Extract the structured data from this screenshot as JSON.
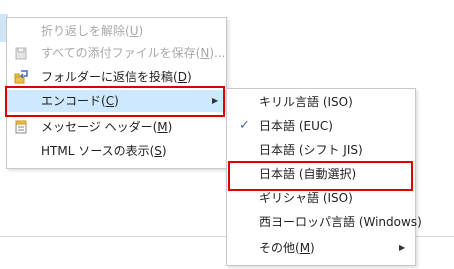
{
  "context_menu": {
    "items": [
      {
        "label": "折り返しを解除(",
        "mnemonic": "U",
        "suffix": ")",
        "disabled": true,
        "icon": "unwrap-icon"
      },
      {
        "label": "すべての添付ファイルを保存(",
        "mnemonic": "N",
        "suffix": ")...",
        "disabled": true,
        "icon": "save-attachments-icon"
      },
      {
        "label": "フォルダーに返信を投稿(",
        "mnemonic": "D",
        "suffix": ")",
        "disabled": false,
        "icon": "post-reply-folder-icon"
      },
      {
        "label": "エンコード(",
        "mnemonic": "C",
        "suffix": ")",
        "disabled": false,
        "active": true,
        "has_submenu": true
      },
      {
        "label": "メッセージ ヘッダー(",
        "mnemonic": "M",
        "suffix": ")",
        "disabled": false,
        "icon": "message-header-icon"
      },
      {
        "label": "HTML ソースの表示(",
        "mnemonic": "S",
        "suffix": ")",
        "disabled": false
      }
    ]
  },
  "encoding_submenu": {
    "items": [
      {
        "label": "キリル言語 (ISO)",
        "checked": false
      },
      {
        "label": "日本語 (EUC)",
        "checked": true
      },
      {
        "label": "日本語 (シフト JIS)",
        "checked": false
      },
      {
        "label": "日本語 (自動選択)",
        "checked": false
      },
      {
        "label": "ギリシャ語 (ISO)",
        "checked": false
      },
      {
        "label": "西ヨーロッパ言語 (Windows)",
        "checked": false
      }
    ],
    "more": {
      "label": "その他(",
      "mnemonic": "M",
      "suffix": ")",
      "has_submenu": true
    }
  },
  "glyphs": {
    "submenu_arrow": "▶",
    "check": "✓"
  },
  "colors": {
    "highlight_border": "#e00000",
    "hover_bg": "#cde8ff",
    "disabled_text": "#a8a8a8"
  }
}
